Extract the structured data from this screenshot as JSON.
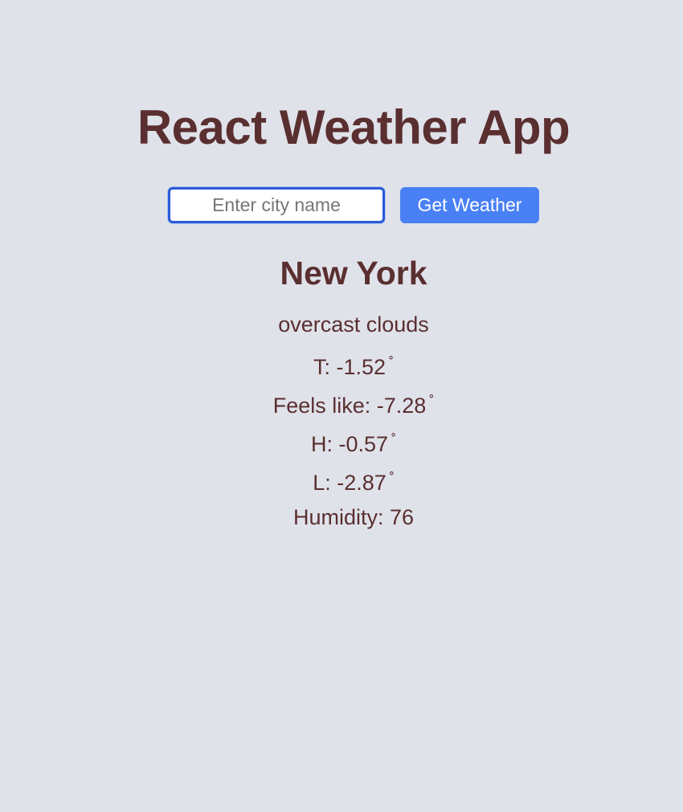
{
  "header": {
    "title": "React Weather App"
  },
  "search": {
    "placeholder": "Enter city name",
    "value": "",
    "button_label": "Get Weather"
  },
  "weather": {
    "city": "New York",
    "description": "overcast clouds",
    "degree_symbol": "˚",
    "temperature": "T: -1.52",
    "feels_like": "Feels like: -7.28",
    "high": "H: -0.57",
    "low": "L: -2.87",
    "humidity": "Humidity: 76"
  },
  "colors": {
    "background": "#e0e2ea",
    "text": "#5a2f30",
    "button": "#4a80f5",
    "input_border": "#2a5bd7"
  }
}
